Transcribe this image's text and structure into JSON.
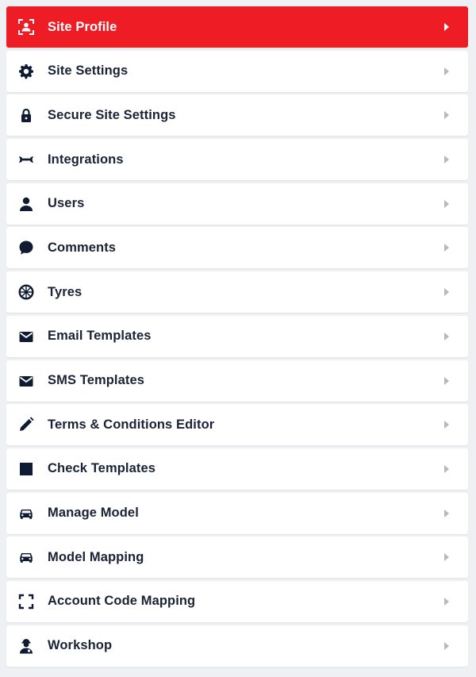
{
  "colors": {
    "active": "#ee1c25",
    "icon": "#0f1b33",
    "chevron": "#b5b8bd"
  },
  "menu": {
    "items": [
      {
        "label": "Site Profile",
        "icon": "site-profile-icon",
        "active": true
      },
      {
        "label": "Site Settings",
        "icon": "gear-icon"
      },
      {
        "label": "Secure Site Settings",
        "icon": "lock-icon"
      },
      {
        "label": "Integrations",
        "icon": "wrench-icon"
      },
      {
        "label": "Users",
        "icon": "user-icon"
      },
      {
        "label": "Comments",
        "icon": "comment-icon"
      },
      {
        "label": "Tyres",
        "icon": "tyre-icon"
      },
      {
        "label": "Email Templates",
        "icon": "envelope-icon"
      },
      {
        "label": "SMS Templates",
        "icon": "envelope-icon"
      },
      {
        "label": "Terms & Conditions Editor",
        "icon": "pencil-icon"
      },
      {
        "label": "Check Templates",
        "icon": "square-icon"
      },
      {
        "label": "Manage Model",
        "icon": "car-icon"
      },
      {
        "label": "Model Mapping",
        "icon": "car-icon"
      },
      {
        "label": "Account Code Mapping",
        "icon": "scan-frame-icon"
      },
      {
        "label": "Workshop",
        "icon": "mechanic-icon"
      }
    ]
  }
}
